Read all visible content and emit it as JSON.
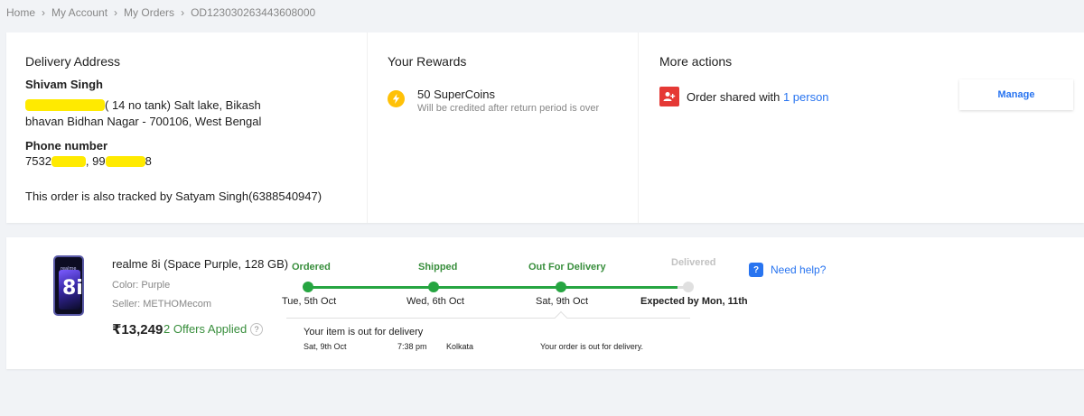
{
  "breadcrumb": [
    "Home",
    "My Account",
    "My Orders",
    "OD123030263443608000"
  ],
  "address": {
    "title": "Delivery Address",
    "name": "Shivam Singh",
    "line1_visible": "( 14 no tank) Salt lake, Bikash",
    "line2": "bhavan Bidhan Nagar - 700106, West Bengal",
    "phone_label": "Phone number",
    "phone_prefix": "7532",
    "phone_mid": ", 99",
    "phone_suffix": "8",
    "tracked_note": "This order is also tracked by Satyam Singh(6388540947)"
  },
  "rewards": {
    "title": "Your Rewards",
    "coins": "50 SuperCoins",
    "note": "Will be credited after return period is over",
    "icon": "bolt-icon",
    "icon_color": "#ffc107"
  },
  "actions": {
    "title": "More actions",
    "share_text": "Order shared with ",
    "share_link": "1 person",
    "manage_label": "Manage",
    "share_icon_color": "#e53935"
  },
  "product": {
    "title": "realme 8i (Space Purple, 128 GB)",
    "color": "Color: Purple",
    "seller": "Seller: METHOMecom",
    "price": "₹13,249",
    "offers": "2 Offers Applied",
    "offers_help": "?",
    "image_label": "realme",
    "image_number": "8i"
  },
  "tracking": {
    "stages": [
      {
        "label": "Ordered",
        "date": "Tue, 5th Oct",
        "done": true
      },
      {
        "label": "Shipped",
        "date": "Wed, 6th Oct",
        "done": true
      },
      {
        "label": "Out For Delivery",
        "date": "Sat, 9th Oct",
        "done": true
      },
      {
        "label": "Delivered",
        "date": "Expected by Mon, 11th",
        "done": false
      }
    ],
    "accent": "#26a541"
  },
  "update": {
    "title": "Your item is out for delivery",
    "date": "Sat, 9th Oct",
    "time": "7:38 pm",
    "place": "Kolkata",
    "message": "Your order is out for delivery."
  },
  "help": {
    "label": "Need help?",
    "icon": "?"
  }
}
